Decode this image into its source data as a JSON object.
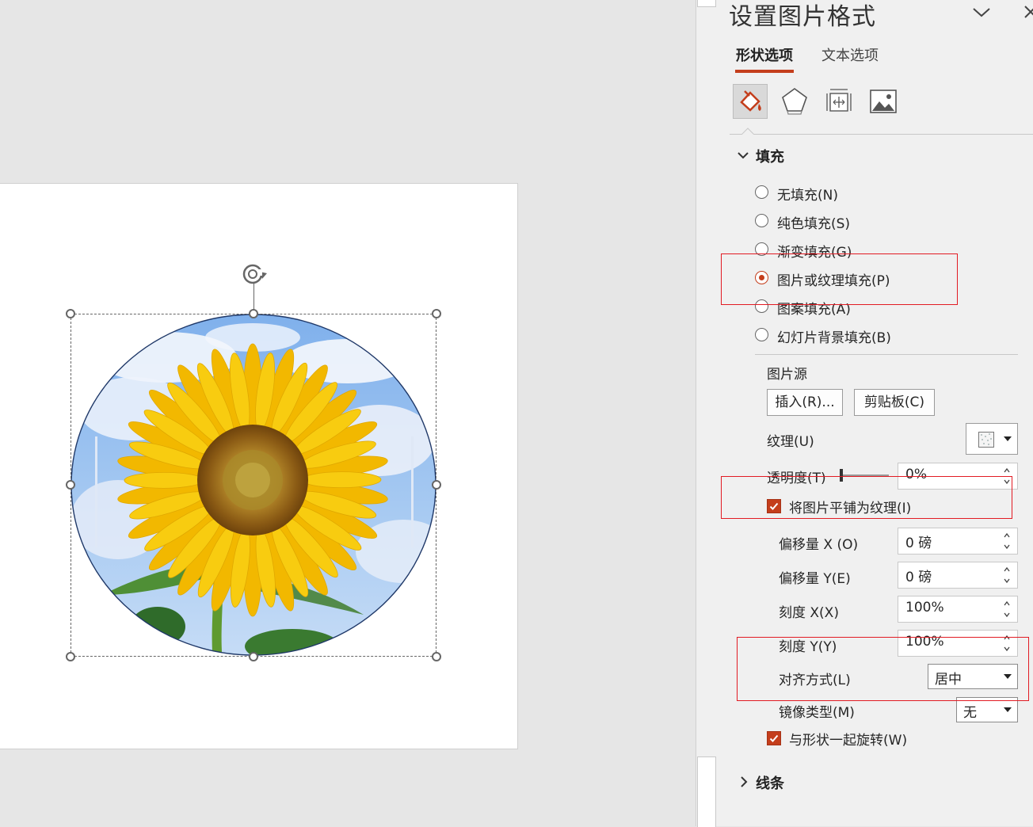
{
  "pane": {
    "title": "设置图片格式",
    "tabs": {
      "shape": "形状选项",
      "text": "文本选项"
    },
    "icons": {
      "collapse": "chevron-down-icon",
      "close": "close-icon",
      "fill_tab": "fill-line-icon",
      "effects_tab": "effects-pentagon-icon",
      "size_tab": "size-properties-icon",
      "picture_tab": "picture-icon"
    },
    "fill_section": {
      "title": "填充",
      "options": [
        {
          "label": "无填充(N)",
          "checked": false
        },
        {
          "label": "纯色填充(S)",
          "checked": false
        },
        {
          "label": "渐变填充(G)",
          "checked": false
        },
        {
          "label": "图片或纹理填充(P)",
          "checked": true
        },
        {
          "label": "图案填充(A)",
          "checked": false
        },
        {
          "label": "幻灯片背景填充(B)",
          "checked": false
        }
      ],
      "picture_source_label": "图片源",
      "insert_button": "插入(R)...",
      "clipboard_button": "剪贴板(C)",
      "texture_label": "纹理(U)",
      "transparency_label": "透明度(T)",
      "transparency_value": "0%",
      "transparency_fraction": 0.0,
      "tile_label": "将图片平铺为纹理(I)",
      "tile_checked": true,
      "offset_x_label": "偏移量 X (O)",
      "offset_x_value": "0 磅",
      "offset_y_label": "偏移量 Y(E)",
      "offset_y_value": "0 磅",
      "scale_x_label": "刻度 X(X)",
      "scale_x_value": "100%",
      "scale_y_label": "刻度 Y(Y)",
      "scale_y_value": "100%",
      "alignment_label": "对齐方式(L)",
      "alignment_value": "居中",
      "mirror_label": "镜像类型(M)",
      "mirror_value": "无",
      "rotate_label": "与形状一起旋转(W)",
      "rotate_checked": true
    },
    "line_section": {
      "title": "线条"
    }
  },
  "colors": {
    "accent": "#c43e1c",
    "annotation": "#e21b23",
    "pane_bg": "#f0f0f0",
    "canvas_bg": "#e6e6e6"
  },
  "slide": {
    "shape": "circle",
    "fill_image": "sunflower against blue sky",
    "rotate_handle_icon": "rotate-handle-icon"
  }
}
